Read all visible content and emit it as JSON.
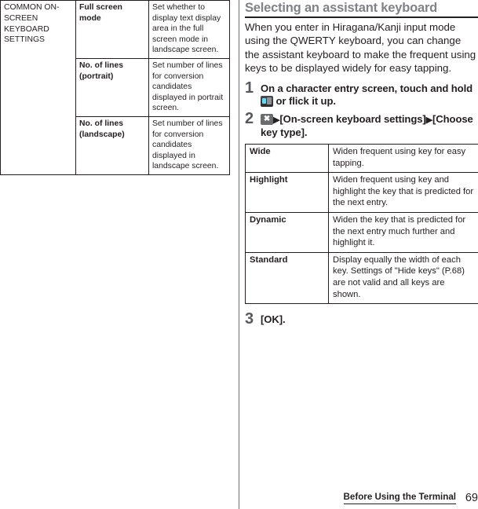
{
  "left_table": {
    "category": "COMMON ON-SCREEN KEYBOARD SETTINGS",
    "rows": [
      {
        "item": "Full screen mode",
        "description": "Set whether to display text display area in the full screen mode in landscape screen."
      },
      {
        "item": "No. of lines (portrait)",
        "description": "Set number of lines for conversion candidates displayed in portrait screen."
      },
      {
        "item": "No. of lines (landscape)",
        "description": "Set number of lines for conversion candidates displayed in landscape screen."
      }
    ]
  },
  "section": {
    "title": "Selecting an assistant keyboard",
    "intro": "When you enter in Hiragana/Kanji input mode using the QWERTY keyboard, you can change the assistant keyboard to make the frequent using keys to be displayed widely for easy tapping."
  },
  "steps": {
    "one": {
      "number": "1",
      "text_before_icon": "On a character entry screen, touch and hold ",
      "icon": "keyboard-switch-icon",
      "text_after_icon": " or flick it up."
    },
    "two": {
      "number": "2",
      "icon": "settings-tool-icon",
      "arrow": "▶",
      "label_1": "[On-screen keyboard settings]",
      "label_2": "[Choose key type]."
    },
    "three": {
      "number": "3",
      "text": "[OK]."
    }
  },
  "key_table": {
    "rows": [
      {
        "name": "Wide",
        "description": "Widen frequent using key for easy tapping."
      },
      {
        "name": "Highlight",
        "description": "Widen frequent using key and highlight the key that is predicted for the next entry."
      },
      {
        "name": "Dynamic",
        "description": "Widen the key that is predicted for the next entry much further and highlight it."
      },
      {
        "name": "Standard",
        "description": "Display equally the width of each key. Settings of \"Hide keys\" (P.68) are not valid and all keys are shown."
      }
    ]
  },
  "footer": {
    "chapter": "Before Using the Terminal",
    "page_number": "69"
  },
  "colors": {
    "title_gray": "#808285",
    "step_number_gray": "#58595b",
    "rule_black": "#231f20",
    "icon_accent_cyan": "#6fd6ee"
  }
}
